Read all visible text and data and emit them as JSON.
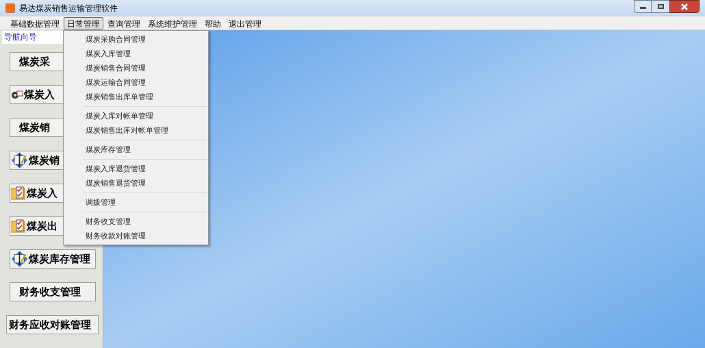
{
  "window": {
    "title": "易达煤炭销售运输管理软件"
  },
  "menubar": [
    {
      "label": "基础数据管理",
      "selected": false
    },
    {
      "label": "日常管理",
      "selected": true
    },
    {
      "label": "查询管理",
      "selected": false
    },
    {
      "label": "系统维护管理",
      "selected": false
    },
    {
      "label": "帮助",
      "selected": false
    },
    {
      "label": "退出管理",
      "selected": false
    }
  ],
  "dropdown_menu": {
    "groups": [
      {
        "items": [
          "煤炭采购合同管理",
          "煤炭入库管理",
          "煤炭销售合同管理",
          "煤炭运输合同管理",
          "煤炭销售出库单管理"
        ]
      },
      {
        "items": [
          "煤炭入库对帐单管理",
          "煤炭销售出库对帐单管理"
        ]
      },
      {
        "items": [
          "煤炭库存管理"
        ]
      },
      {
        "items": [
          "煤炭入库退货管理",
          "煤炭销售退货管理"
        ]
      },
      {
        "items": [
          "调拨管理"
        ]
      },
      {
        "items": [
          "财务收支管理",
          "财务收款对账管理"
        ]
      }
    ]
  },
  "sidebar": {
    "title": "导航向导",
    "buttons": [
      {
        "label": "煤炭采",
        "kind": "plain"
      },
      {
        "label": "煤炭入",
        "kind": "gear"
      },
      {
        "label": "煤炭销",
        "kind": "plain"
      },
      {
        "label": "煤炭销",
        "kind": "book"
      },
      {
        "label": "煤炭入",
        "kind": "folder"
      },
      {
        "label": "煤炭出",
        "kind": "folder"
      },
      {
        "label": "煤炭库存管理",
        "kind": "book"
      },
      {
        "label": "财务收支管理",
        "kind": "plain"
      },
      {
        "label": "财务应收对账管理",
        "kind": "plain"
      }
    ]
  }
}
